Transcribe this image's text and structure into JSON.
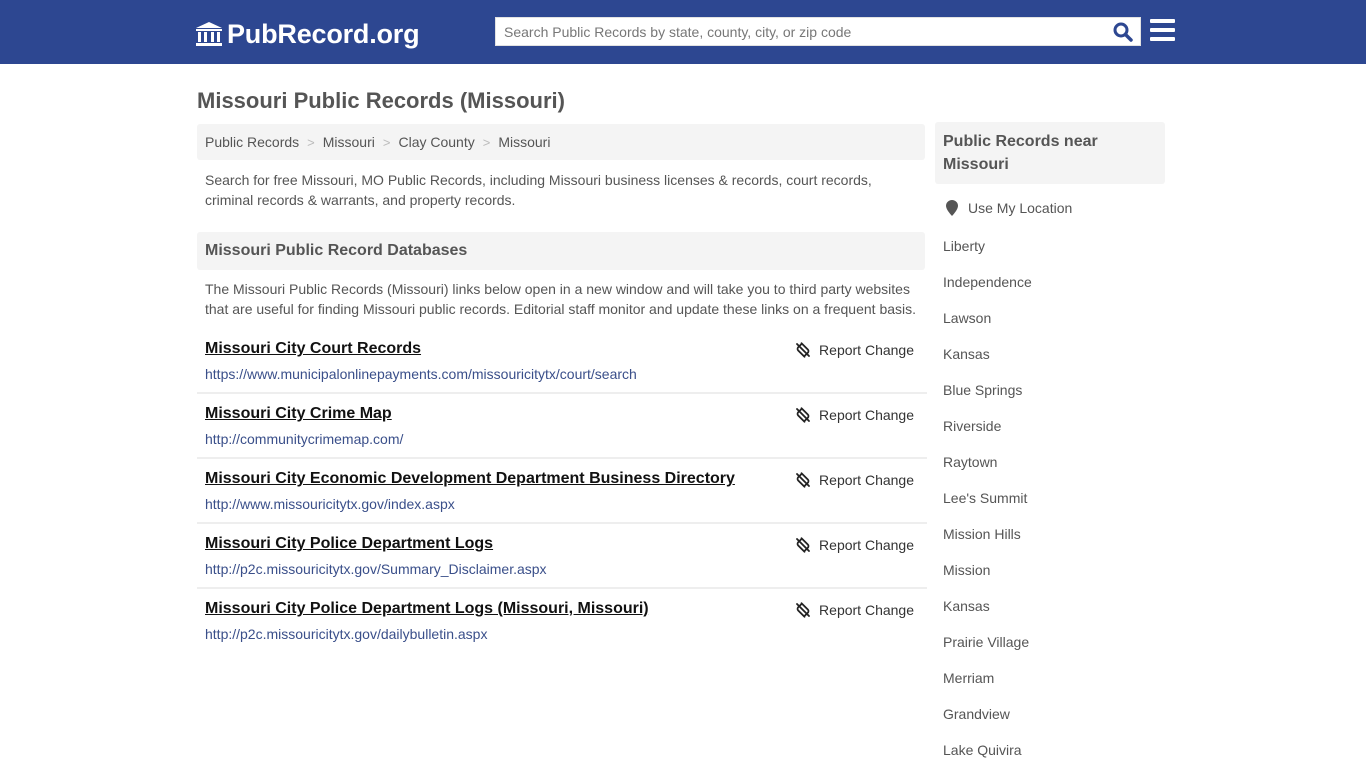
{
  "header": {
    "logo_text": "PubRecord.org",
    "search_placeholder": "Search Public Records by state, county, city, or zip code",
    "search_value": "",
    "colors": {
      "brand_bar": "#2d4791",
      "search_icon": "#2d4791"
    }
  },
  "page": {
    "title": "Missouri Public Records (Missouri)",
    "breadcrumb": [
      "Public Records",
      "Missouri",
      "Clay County",
      "Missouri"
    ],
    "breadcrumb_separator": ">",
    "intro": "Search for free Missouri, MO Public Records, including Missouri business licenses & records, court records, criminal records & warrants, and property records."
  },
  "databases": {
    "heading": "Missouri Public Record Databases",
    "description": "The Missouri Public Records (Missouri) links below open in a new window and will take you to third party websites that are useful for finding Missouri public records. Editorial staff monitor and update these links on a frequent basis.",
    "report_label": "Report Change",
    "records": [
      {
        "title": "Missouri City Court Records",
        "url": "https://www.municipalonlinepayments.com/missouricitytx/court/search"
      },
      {
        "title": "Missouri City Crime Map",
        "url": "http://communitycrimemap.com/"
      },
      {
        "title": "Missouri City Economic Development Department Business Directory",
        "url": "http://www.missouricitytx.gov/index.aspx"
      },
      {
        "title": "Missouri City Police Department Logs",
        "url": "http://p2c.missouricitytx.gov/Summary_Disclaimer.aspx"
      },
      {
        "title": "Missouri City Police Department Logs (Missouri, Missouri)",
        "url": "http://p2c.missouricitytx.gov/dailybulletin.aspx"
      }
    ]
  },
  "sidebar": {
    "heading": "Public Records near Missouri",
    "use_location_label": "Use My Location",
    "nearby": [
      "Liberty",
      "Independence",
      "Lawson",
      "Kansas",
      "Blue Springs",
      "Riverside",
      "Raytown",
      "Lee's Summit",
      "Mission Hills",
      "Mission",
      "Kansas",
      "Prairie Village",
      "Merriam",
      "Grandview",
      "Lake Quivira"
    ]
  }
}
